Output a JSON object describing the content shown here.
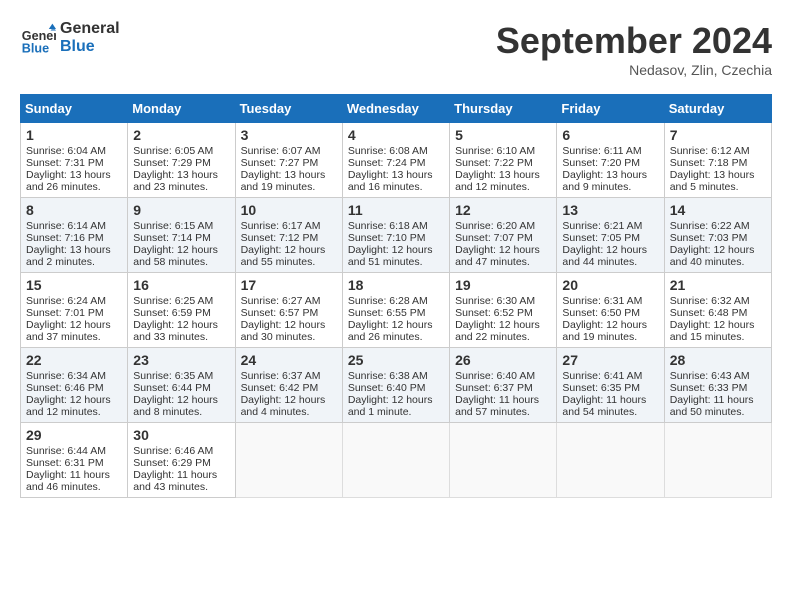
{
  "logo": {
    "line1": "General",
    "line2": "Blue"
  },
  "title": "September 2024",
  "subtitle": "Nedasov, Zlin, Czechia",
  "days_of_week": [
    "Sunday",
    "Monday",
    "Tuesday",
    "Wednesday",
    "Thursday",
    "Friday",
    "Saturday"
  ],
  "weeks": [
    [
      {
        "day": 1,
        "lines": [
          "Sunrise: 6:04 AM",
          "Sunset: 7:31 PM",
          "Daylight: 13 hours",
          "and 26 minutes."
        ]
      },
      {
        "day": 2,
        "lines": [
          "Sunrise: 6:05 AM",
          "Sunset: 7:29 PM",
          "Daylight: 13 hours",
          "and 23 minutes."
        ]
      },
      {
        "day": 3,
        "lines": [
          "Sunrise: 6:07 AM",
          "Sunset: 7:27 PM",
          "Daylight: 13 hours",
          "and 19 minutes."
        ]
      },
      {
        "day": 4,
        "lines": [
          "Sunrise: 6:08 AM",
          "Sunset: 7:24 PM",
          "Daylight: 13 hours",
          "and 16 minutes."
        ]
      },
      {
        "day": 5,
        "lines": [
          "Sunrise: 6:10 AM",
          "Sunset: 7:22 PM",
          "Daylight: 13 hours",
          "and 12 minutes."
        ]
      },
      {
        "day": 6,
        "lines": [
          "Sunrise: 6:11 AM",
          "Sunset: 7:20 PM",
          "Daylight: 13 hours",
          "and 9 minutes."
        ]
      },
      {
        "day": 7,
        "lines": [
          "Sunrise: 6:12 AM",
          "Sunset: 7:18 PM",
          "Daylight: 13 hours",
          "and 5 minutes."
        ]
      }
    ],
    [
      {
        "day": 8,
        "lines": [
          "Sunrise: 6:14 AM",
          "Sunset: 7:16 PM",
          "Daylight: 13 hours",
          "and 2 minutes."
        ]
      },
      {
        "day": 9,
        "lines": [
          "Sunrise: 6:15 AM",
          "Sunset: 7:14 PM",
          "Daylight: 12 hours",
          "and 58 minutes."
        ]
      },
      {
        "day": 10,
        "lines": [
          "Sunrise: 6:17 AM",
          "Sunset: 7:12 PM",
          "Daylight: 12 hours",
          "and 55 minutes."
        ]
      },
      {
        "day": 11,
        "lines": [
          "Sunrise: 6:18 AM",
          "Sunset: 7:10 PM",
          "Daylight: 12 hours",
          "and 51 minutes."
        ]
      },
      {
        "day": 12,
        "lines": [
          "Sunrise: 6:20 AM",
          "Sunset: 7:07 PM",
          "Daylight: 12 hours",
          "and 47 minutes."
        ]
      },
      {
        "day": 13,
        "lines": [
          "Sunrise: 6:21 AM",
          "Sunset: 7:05 PM",
          "Daylight: 12 hours",
          "and 44 minutes."
        ]
      },
      {
        "day": 14,
        "lines": [
          "Sunrise: 6:22 AM",
          "Sunset: 7:03 PM",
          "Daylight: 12 hours",
          "and 40 minutes."
        ]
      }
    ],
    [
      {
        "day": 15,
        "lines": [
          "Sunrise: 6:24 AM",
          "Sunset: 7:01 PM",
          "Daylight: 12 hours",
          "and 37 minutes."
        ]
      },
      {
        "day": 16,
        "lines": [
          "Sunrise: 6:25 AM",
          "Sunset: 6:59 PM",
          "Daylight: 12 hours",
          "and 33 minutes."
        ]
      },
      {
        "day": 17,
        "lines": [
          "Sunrise: 6:27 AM",
          "Sunset: 6:57 PM",
          "Daylight: 12 hours",
          "and 30 minutes."
        ]
      },
      {
        "day": 18,
        "lines": [
          "Sunrise: 6:28 AM",
          "Sunset: 6:55 PM",
          "Daylight: 12 hours",
          "and 26 minutes."
        ]
      },
      {
        "day": 19,
        "lines": [
          "Sunrise: 6:30 AM",
          "Sunset: 6:52 PM",
          "Daylight: 12 hours",
          "and 22 minutes."
        ]
      },
      {
        "day": 20,
        "lines": [
          "Sunrise: 6:31 AM",
          "Sunset: 6:50 PM",
          "Daylight: 12 hours",
          "and 19 minutes."
        ]
      },
      {
        "day": 21,
        "lines": [
          "Sunrise: 6:32 AM",
          "Sunset: 6:48 PM",
          "Daylight: 12 hours",
          "and 15 minutes."
        ]
      }
    ],
    [
      {
        "day": 22,
        "lines": [
          "Sunrise: 6:34 AM",
          "Sunset: 6:46 PM",
          "Daylight: 12 hours",
          "and 12 minutes."
        ]
      },
      {
        "day": 23,
        "lines": [
          "Sunrise: 6:35 AM",
          "Sunset: 6:44 PM",
          "Daylight: 12 hours",
          "and 8 minutes."
        ]
      },
      {
        "day": 24,
        "lines": [
          "Sunrise: 6:37 AM",
          "Sunset: 6:42 PM",
          "Daylight: 12 hours",
          "and 4 minutes."
        ]
      },
      {
        "day": 25,
        "lines": [
          "Sunrise: 6:38 AM",
          "Sunset: 6:40 PM",
          "Daylight: 12 hours",
          "and 1 minute."
        ]
      },
      {
        "day": 26,
        "lines": [
          "Sunrise: 6:40 AM",
          "Sunset: 6:37 PM",
          "Daylight: 11 hours",
          "and 57 minutes."
        ]
      },
      {
        "day": 27,
        "lines": [
          "Sunrise: 6:41 AM",
          "Sunset: 6:35 PM",
          "Daylight: 11 hours",
          "and 54 minutes."
        ]
      },
      {
        "day": 28,
        "lines": [
          "Sunrise: 6:43 AM",
          "Sunset: 6:33 PM",
          "Daylight: 11 hours",
          "and 50 minutes."
        ]
      }
    ],
    [
      {
        "day": 29,
        "lines": [
          "Sunrise: 6:44 AM",
          "Sunset: 6:31 PM",
          "Daylight: 11 hours",
          "and 46 minutes."
        ]
      },
      {
        "day": 30,
        "lines": [
          "Sunrise: 6:46 AM",
          "Sunset: 6:29 PM",
          "Daylight: 11 hours",
          "and 43 minutes."
        ]
      },
      null,
      null,
      null,
      null,
      null
    ]
  ]
}
